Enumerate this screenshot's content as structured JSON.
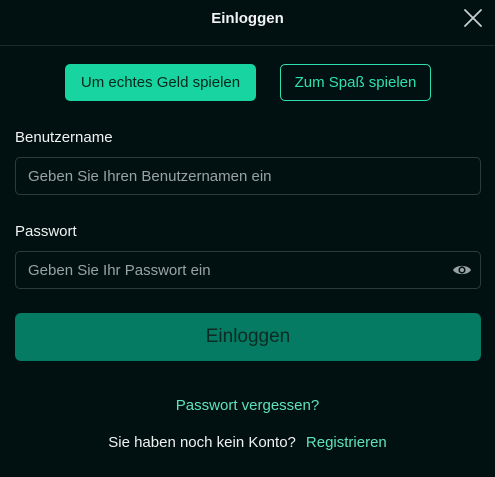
{
  "header": {
    "title": "Einloggen",
    "close_icon": "close-icon"
  },
  "mode": {
    "real_money": "Um echtes Geld spielen",
    "for_fun": "Zum Spaß spielen",
    "selected": "real_money"
  },
  "username": {
    "label": "Benutzername",
    "value": "",
    "placeholder": "Geben Sie Ihren Benutzernamen ein"
  },
  "password": {
    "label": "Passwort",
    "value": "",
    "placeholder": "Geben Sie Ihr Passwort ein",
    "toggle_icon": "eye-icon"
  },
  "submit": {
    "label": "Einloggen"
  },
  "forgot": {
    "label": "Passwort vergessen?"
  },
  "signup": {
    "prompt": "Sie haben noch kein Konto?",
    "link": "Registrieren"
  },
  "colors": {
    "background": "#011111",
    "accent": "#17d4a0",
    "submit_bg": "#047b62",
    "link": "#5fe3bd"
  }
}
